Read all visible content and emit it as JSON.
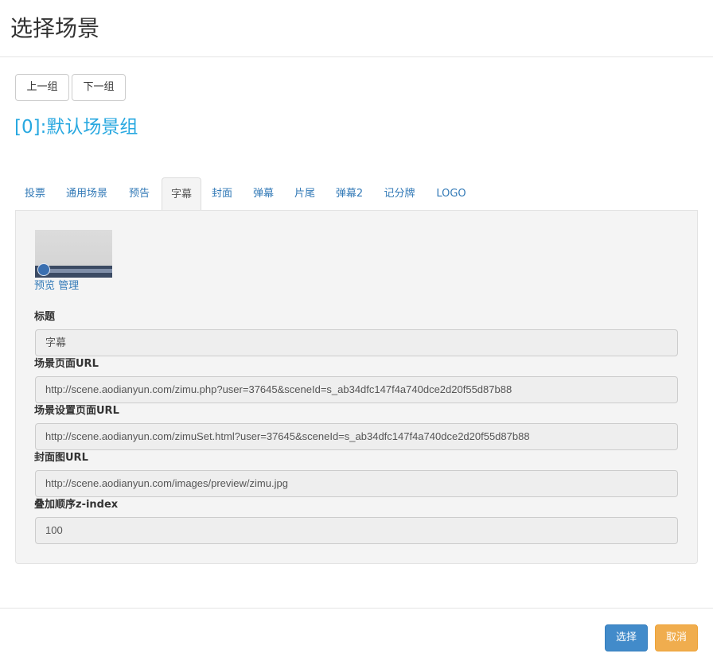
{
  "modal": {
    "title": "选择场景"
  },
  "nav": {
    "prev_label": "上一组",
    "next_label": "下一组"
  },
  "group": {
    "title": "[0]:默认场景组"
  },
  "tabs": [
    {
      "label": "投票"
    },
    {
      "label": "通用场景"
    },
    {
      "label": "预告"
    },
    {
      "label": "字幕",
      "active": true
    },
    {
      "label": "封面"
    },
    {
      "label": "弹幕"
    },
    {
      "label": "片尾"
    },
    {
      "label": "弹幕2"
    },
    {
      "label": "记分牌"
    },
    {
      "label": "LOGO"
    }
  ],
  "scene": {
    "preview_label": "预览",
    "manage_label": "管理",
    "fields": {
      "title": {
        "label": "标题",
        "value": "字幕"
      },
      "page_url": {
        "label": "场景页面URL",
        "value": "http://scene.aodianyun.com/zimu.php?user=37645&sceneId=s_ab34dfc147f4a740dce2d20f55d87b88"
      },
      "settings_url": {
        "label": "场景设置页面URL",
        "value": "http://scene.aodianyun.com/zimuSet.html?user=37645&sceneId=s_ab34dfc147f4a740dce2d20f55d87b88"
      },
      "cover_url": {
        "label": "封面图URL",
        "value": "http://scene.aodianyun.com/images/preview/zimu.jpg"
      },
      "z_index": {
        "label": "叠加顺序z-index",
        "value": "100"
      }
    }
  },
  "footer": {
    "select_label": "选择",
    "cancel_label": "取消"
  },
  "colors": {
    "accent": "#28a8e0",
    "primary": "#428bca",
    "warning": "#f0ad4e",
    "link": "#337ab7"
  }
}
